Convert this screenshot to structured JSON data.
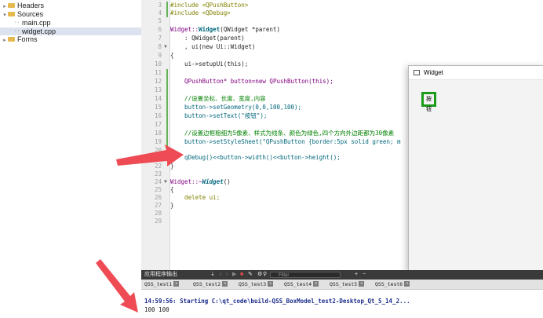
{
  "tree": {
    "headers": "Headers",
    "sources": "Sources",
    "main_cpp": "main.cpp",
    "widget_cpp": "widget.cpp",
    "forms": "Forms"
  },
  "editor": {
    "line_numbers": [
      "3",
      "4",
      "5",
      "6",
      "7",
      "8",
      "9",
      "10",
      "11",
      "12",
      "13",
      "14",
      "15",
      "16",
      "17",
      "18",
      "19",
      "20",
      "21",
      "22",
      "23",
      "24",
      "25",
      "26",
      "27",
      "28",
      "29"
    ],
    "lines": {
      "l3": "#include <QPushButton>",
      "l4": "#include <QDebug>",
      "l6a": "Widget::",
      "l6b": "Widget",
      "l6c": "(QWidget *parent)",
      "l7a": "    : QWidget(parent)",
      "l8a": "    , ui(new Ui::Widget)",
      "l9": "{",
      "l10": "    ui->setupUi(this);",
      "l12": "    QPushButton* button=new QPushButton(this);",
      "l14": "    //设置坐标、长度、宽度,内容",
      "l15": "    button->setGeometry(0,0,100,100);",
      "l16": "    button->setText(\"按钮\");",
      "l18": "    //设置边框粗细为5像素、样式为线条、颜色为绿色,四个方向外边距都为30像素",
      "l19": "    button->setStyleSheet(\"QPushButton {border:5px solid green; m",
      "l21": "    qDebug()<<button->width()<<button->height();",
      "l22": "}",
      "l24a": "Widget::~",
      "l24b": "Widget",
      "l24c": "()",
      "l25": "{",
      "l26": "    delete ui;",
      "l27": "}"
    }
  },
  "widget_window": {
    "title": "Widget",
    "button_text": "按钮"
  },
  "output_bar": {
    "title": "应用程序输出",
    "filter_placeholder": "Filter"
  },
  "output_tabs": [
    "QSS_test1",
    "QSS_test2",
    "QSS_test3",
    "QSS_test4",
    "QSS_test5",
    "QSS_test6"
  ],
  "output": {
    "start_line": "14:59:56: Starting C:\\qt_code\\build-QSS_BoxModel_test2-Desktop_Qt_5_14_2...",
    "result_line": "100 100"
  },
  "colors": {
    "arrow": "#ef4b55",
    "button_border": "#1a9c1a"
  }
}
